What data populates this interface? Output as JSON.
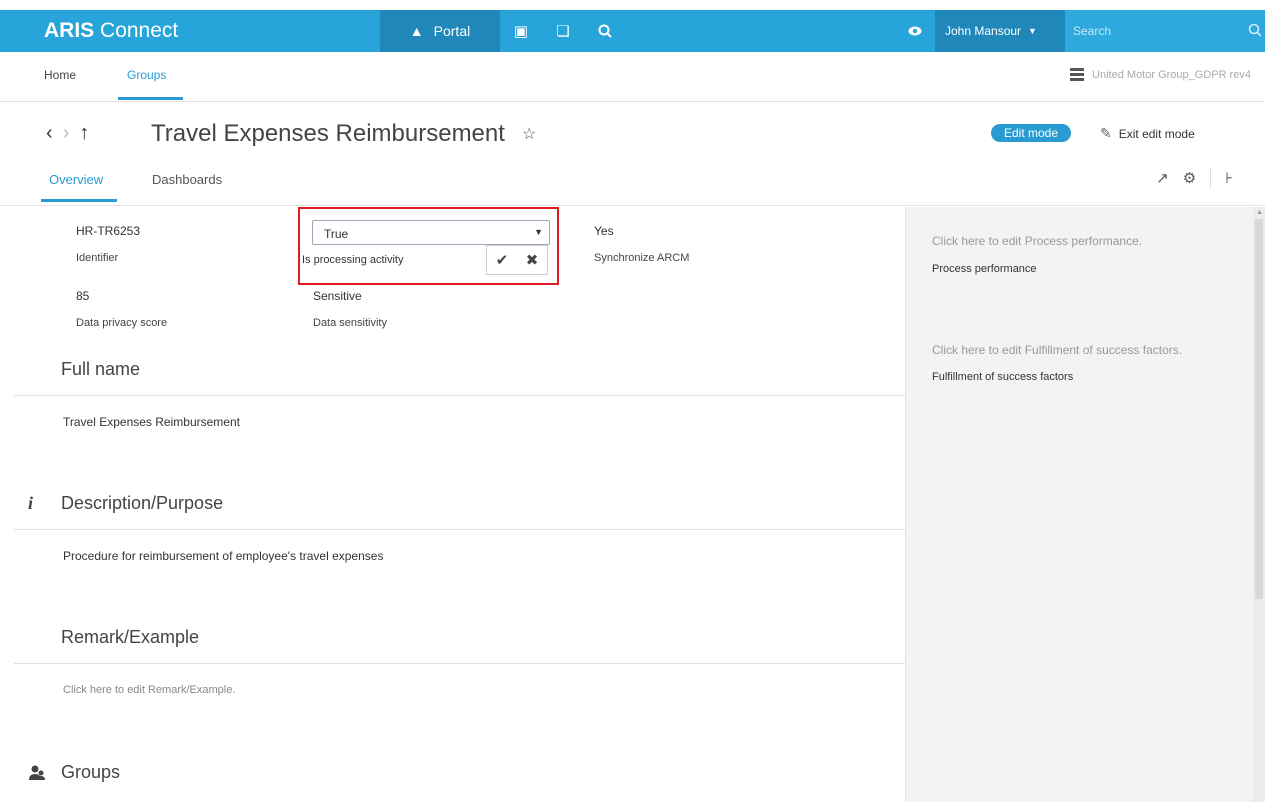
{
  "app": {
    "brand_bold": "ARIS",
    "brand_light": " Connect"
  },
  "topnav": {
    "portal_label": "Portal",
    "user_name": "John Mansour",
    "search_placeholder": "Search"
  },
  "subnav": {
    "home_label": "Home",
    "groups_label": "Groups",
    "database_name": "United Motor Group_GDPR rev4"
  },
  "header": {
    "title": "Travel Expenses Reimbursement",
    "edit_mode_label": "Edit mode",
    "exit_edit_label": "Exit edit mode",
    "tabs": [
      {
        "label": "Overview"
      },
      {
        "label": "Dashboards"
      }
    ]
  },
  "attributes": {
    "identifier_value": "HR-TR6253",
    "identifier_label": "Identifier",
    "privacy_score_value": "85",
    "privacy_score_label": "Data privacy score",
    "sensitivity_value": "Sensitive",
    "sensitivity_label": "Data sensitivity",
    "sync_value": "Yes",
    "sync_label": "Synchronize ARCM"
  },
  "edit_popup": {
    "selected_value": "True",
    "field_label": "Is processing activity"
  },
  "sections": {
    "full_name_title": "Full name",
    "full_name_text": "Travel Expenses Reimbursement",
    "description_title": "Description/Purpose",
    "description_text": "Procedure for reimbursement of employee's travel expenses",
    "remark_title": "Remark/Example",
    "remark_placeholder": "Click here to edit Remark/Example.",
    "groups_title": "Groups"
  },
  "right_panel": {
    "performance_hint": "Click here to edit Process performance.",
    "performance_label": "Process performance",
    "success_hint": "Click here to edit Fulfillment of success factors.",
    "success_label": "Fulfillment of success factors"
  },
  "colors": {
    "accent": "#27a4d9",
    "accent_dark": "#1f87b9",
    "highlight_border": "#e11b22"
  },
  "icons": [
    "portal-icon",
    "model-icon",
    "collaboration-icon",
    "search-icon",
    "eye-icon",
    "chevron-down-icon",
    "database-icon",
    "back-icon",
    "forward-icon",
    "up-icon",
    "star-icon",
    "pen-icon",
    "export-icon",
    "settings-icon",
    "tree-icon",
    "info-icon",
    "groups-icon",
    "check-icon",
    "close-icon"
  ]
}
